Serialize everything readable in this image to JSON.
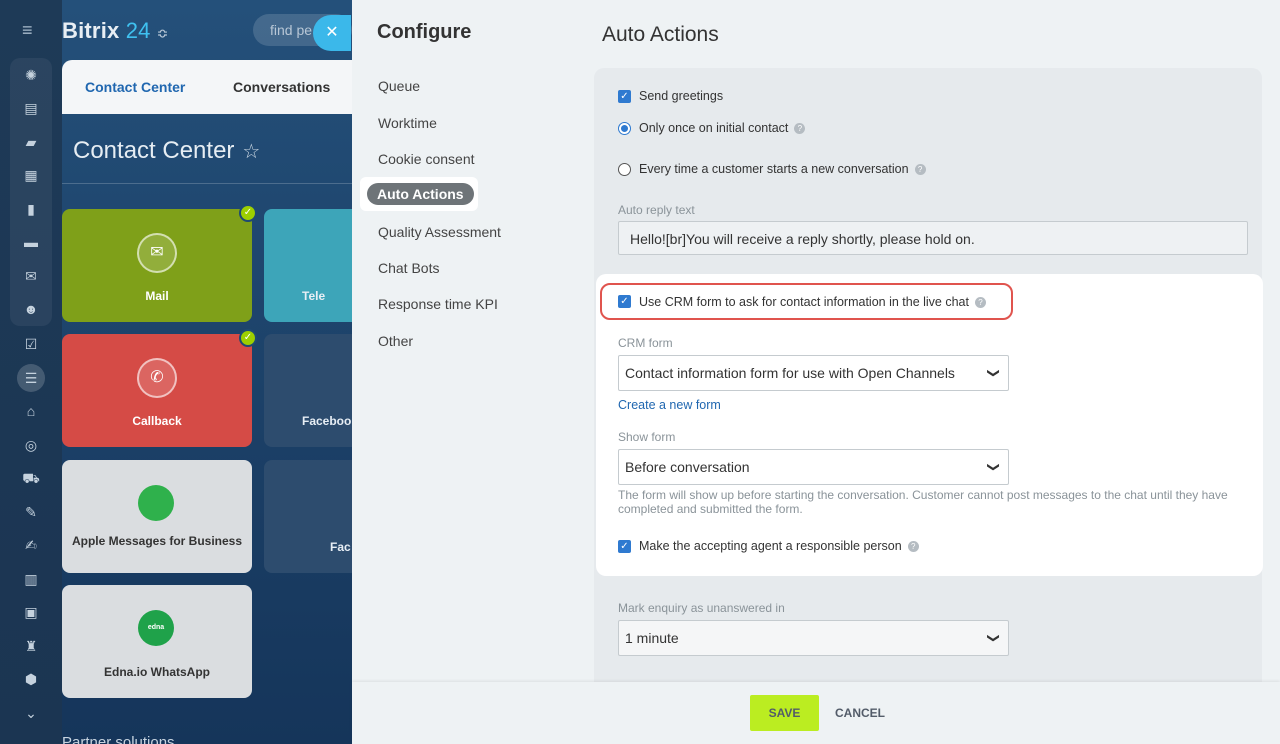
{
  "app": {
    "brand_name": "Bitrix",
    "brand_num": "24",
    "search_placeholder": "find pe"
  },
  "tabs": [
    "Contact Center",
    "Conversations"
  ],
  "page_title": "Contact Center",
  "tiles": {
    "mail": "Mail",
    "tele": "Tele",
    "callback": "Callback",
    "facebook": "Faceboo",
    "apple": "Apple Messages for Business",
    "fac": "Fac",
    "edna": "Edna.io WhatsApp",
    "edna_logo": "edna"
  },
  "partner": "Partner solutions",
  "configure": {
    "title": "Configure",
    "nav": [
      "Queue",
      "Worktime",
      "Cookie consent",
      "Auto Actions",
      "Quality Assessment",
      "Chat Bots",
      "Response time KPI",
      "Other"
    ],
    "active": "Auto Actions"
  },
  "auto_actions": {
    "title": "Auto Actions",
    "send_greetings": "Send greetings",
    "only_once": "Only once on initial contact",
    "every_time": "Every time a customer starts a new conversation",
    "auto_reply_caption": "Auto reply text",
    "auto_reply_value": "Hello![br]You will receive a reply shortly, please hold on.",
    "use_crm_form": "Use CRM form to ask for contact information in the live chat",
    "crm_form_caption": "CRM form",
    "crm_form_value": "Contact information form for use with Open Channels",
    "create_form_link": "Create a new form",
    "show_form_caption": "Show form",
    "show_form_value": "Before conversation",
    "show_form_note": "The form will show up before starting the conversation. Customer cannot post messages to the chat until they have completed and submitted the form.",
    "make_responsible": "Make the accepting agent a responsible person",
    "unanswered_caption": "Mark enquiry as unanswered in",
    "unanswered_value": "1 minute"
  },
  "footer": {
    "save": "SAVE",
    "cancel": "CANCEL"
  },
  "colors": {
    "accent": "#2f7ad0",
    "save": "#bbed21",
    "highlight": "#e0544e"
  }
}
